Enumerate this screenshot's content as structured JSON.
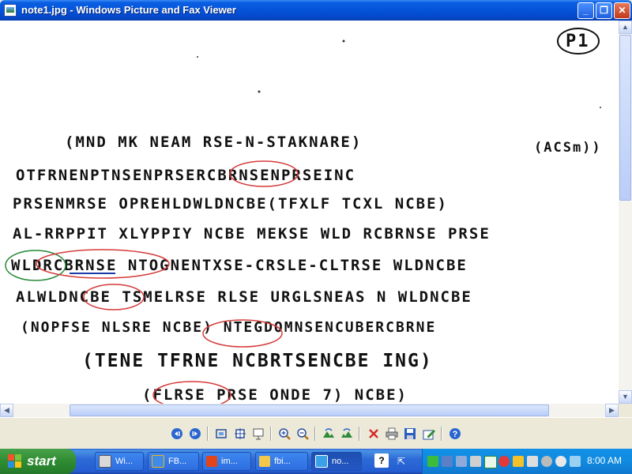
{
  "window": {
    "title": "note1.jpg - Windows Picture and Fax Viewer"
  },
  "note": {
    "page_label": "P1",
    "side_note": "(ACSm))",
    "lines": [
      "(MND MK NEAM RSE-N-STAKNARE)",
      "OTFRNENPTNSENPRSERCBRNSENPRSEINC",
      "PRSENMRSE OPREHLDWLDNCBE(TFXLF TCXL NCBE)",
      "AL-RRPPIT XLYPPIY NCBE MEKSE WLD RCBRNSE PRSE",
      "WLDRCBRNSE NTOGNENTXSE-CRSLE-CLTRSE WLDNCBE",
      "ALWLDNCBE TSMELRSE RLSE URGLSNEAS N WLDNCBE",
      "(NOPFSE NLSRE NCBE) NTEGDOMNSENCUBERCBRNE",
      "(TENE TFRNE NCBRTSENCBE ING)",
      "(FLRSE PRSE ONDE 7) NCBE)"
    ]
  },
  "toolbar": {
    "items": [
      {
        "name": "previous-image",
        "icon": "prev-icon"
      },
      {
        "name": "next-image",
        "icon": "next-icon"
      },
      {
        "name": "best-fit",
        "icon": "best-fit-icon"
      },
      {
        "name": "actual-size",
        "icon": "actual-size-icon"
      },
      {
        "name": "slideshow",
        "icon": "slideshow-icon"
      },
      {
        "name": "zoom-in",
        "icon": "zoom-in-icon"
      },
      {
        "name": "zoom-out",
        "icon": "zoom-out-icon"
      },
      {
        "name": "rotate-clockwise",
        "icon": "rotate-cw-icon"
      },
      {
        "name": "rotate-counterclockwise",
        "icon": "rotate-ccw-icon"
      },
      {
        "name": "delete",
        "icon": "delete-icon"
      },
      {
        "name": "print",
        "icon": "print-icon"
      },
      {
        "name": "save",
        "icon": "save-icon"
      },
      {
        "name": "edit",
        "icon": "edit-icon"
      },
      {
        "name": "help",
        "icon": "help-icon"
      }
    ]
  },
  "taskbar": {
    "start_label": "start",
    "tasks": [
      "Wi...",
      "FB...",
      "im...",
      "fbi...",
      "no..."
    ],
    "clock": "8:00 AM"
  },
  "colors": {
    "title_bar": "#0553d8",
    "circle_red": "#d63a3a",
    "circle_green": "#2a8a3a",
    "underline_blue": "#1a3aa8"
  }
}
